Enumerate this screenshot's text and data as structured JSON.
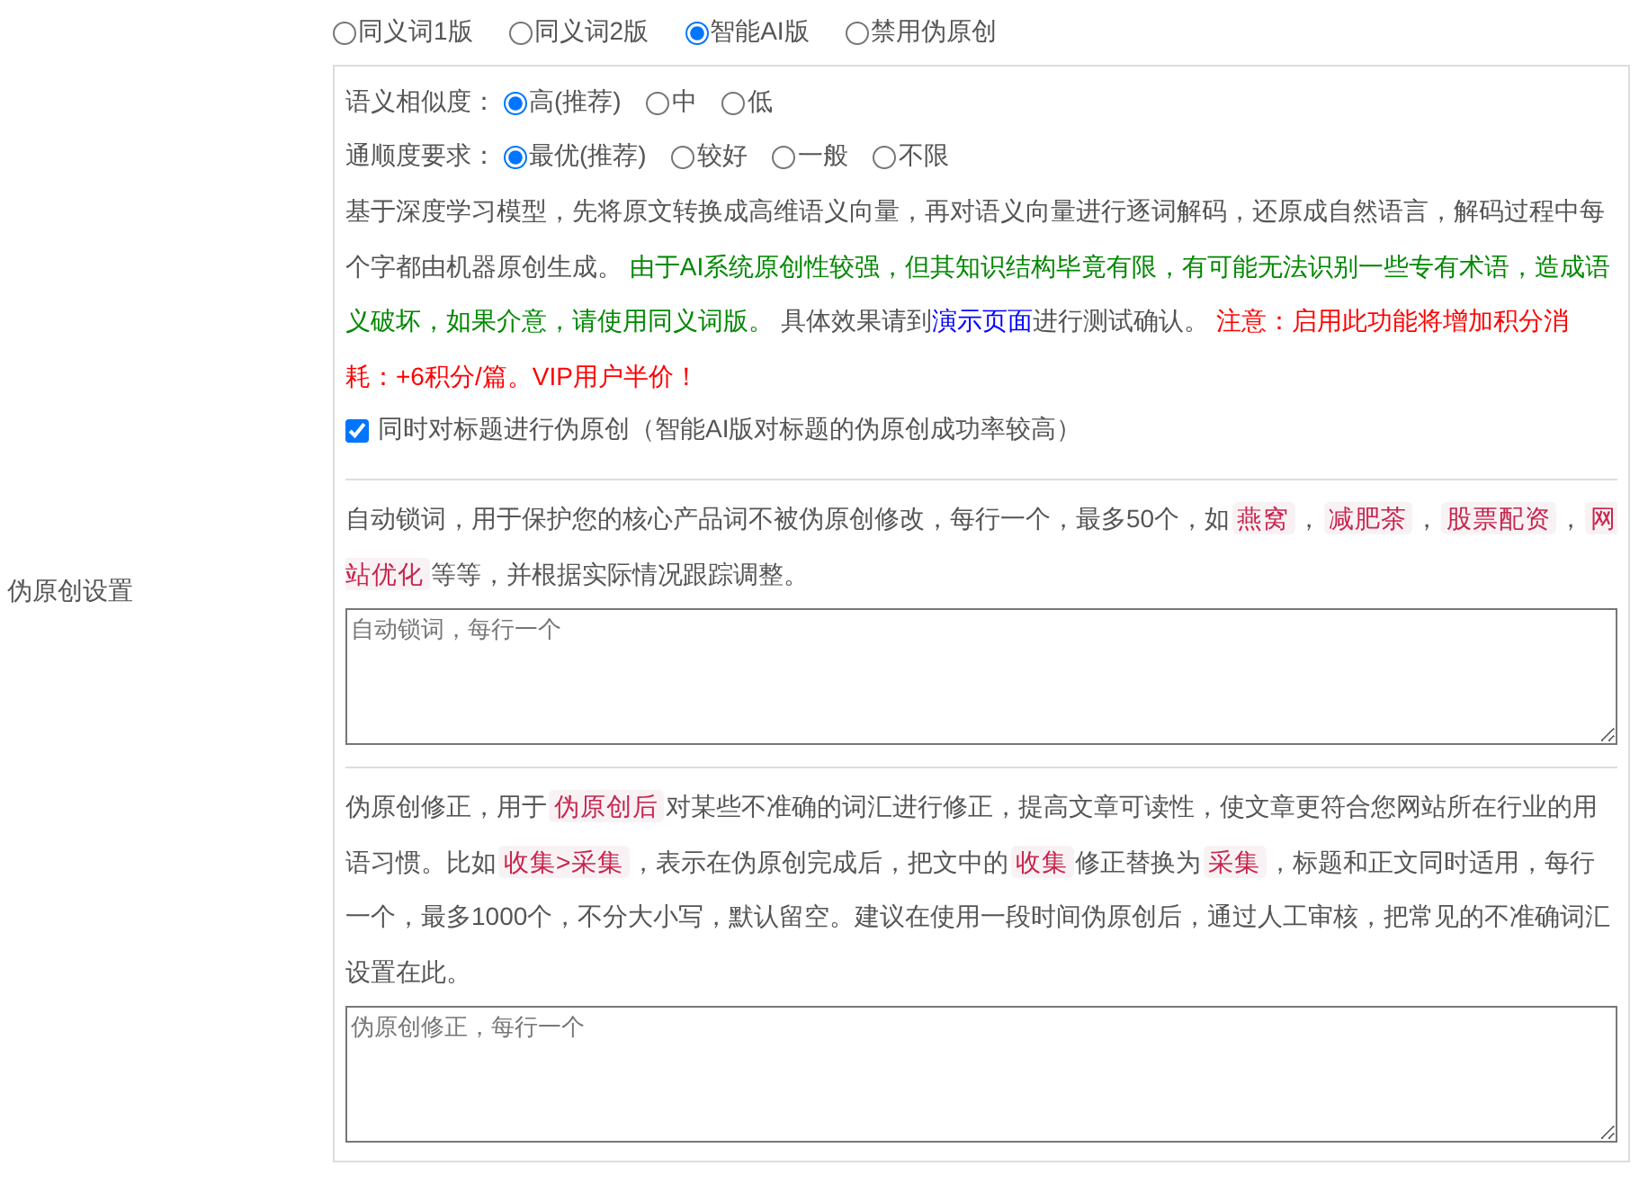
{
  "label": "伪原创设置",
  "versions": [
    {
      "label": "同义词1版",
      "selected": false
    },
    {
      "label": "同义词2版",
      "selected": false
    },
    {
      "label": "智能AI版",
      "selected": true
    },
    {
      "label": "禁用伪原创",
      "selected": false
    }
  ],
  "similarity": {
    "label": "语义相似度：",
    "options": [
      {
        "label": "高(推荐)",
        "selected": true
      },
      {
        "label": "中",
        "selected": false
      },
      {
        "label": "低",
        "selected": false
      }
    ]
  },
  "fluency": {
    "label": "通顺度要求：",
    "options": [
      {
        "label": "最优(推荐)",
        "selected": true
      },
      {
        "label": "较好",
        "selected": false
      },
      {
        "label": "一般",
        "selected": false
      },
      {
        "label": "不限",
        "selected": false
      }
    ]
  },
  "ai_description": [
    {
      "kind": "text",
      "text": "基于深度学习模型，先将原文转换成高维语义向量，再对语义向量进行逐词解码，还原成自然语言，解码过程中每个字都由机器原创生成。 "
    },
    {
      "kind": "notice",
      "text": "由于AI系统原创性较强，但其知识结构毕竟有限，有可能无法识别一些专有术语，造成语义破坏，如果介意，请使用同义词版。"
    },
    {
      "kind": "text",
      "text": " 具体效果请到"
    },
    {
      "kind": "link",
      "text": "演示页面"
    },
    {
      "kind": "text",
      "text": "进行测试确认。 "
    },
    {
      "kind": "warning",
      "text": "注意：启用此功能将增加积分消耗：+6积分/篇。VIP用户半价！"
    }
  ],
  "title_option": {
    "label": "同时对标题进行伪原创（智能AI版对标题的伪原创成功率较高）",
    "checked": true
  },
  "lock_words": {
    "description": [
      {
        "kind": "text",
        "text": "自动锁词，用于保护您的核心产品词不被伪原创修改，每行一个，最多50个，如"
      },
      {
        "kind": "code",
        "text": "燕窝"
      },
      {
        "kind": "text",
        "text": "，"
      },
      {
        "kind": "code",
        "text": "减肥茶"
      },
      {
        "kind": "text",
        "text": "，"
      },
      {
        "kind": "code",
        "text": "股票配资"
      },
      {
        "kind": "text",
        "text": "，"
      },
      {
        "kind": "code",
        "text": "网站优化"
      },
      {
        "kind": "text",
        "text": "等等，并根据实际情况跟踪调整。"
      }
    ],
    "placeholder": "自动锁词，每行一个"
  },
  "correction": {
    "description": [
      {
        "kind": "text",
        "text": "伪原创修正，用于"
      },
      {
        "kind": "code",
        "text": "伪原创后"
      },
      {
        "kind": "text",
        "text": "对某些不准确的词汇进行修正，提高文章可读性，使文章更符合您网站所在行业的用语习惯。比如"
      },
      {
        "kind": "code",
        "text": "收集>采集"
      },
      {
        "kind": "text",
        "text": "，表示在伪原创完成后，把文中的"
      },
      {
        "kind": "code",
        "text": "收集"
      },
      {
        "kind": "text",
        "text": "修正替换为"
      },
      {
        "kind": "code",
        "text": "采集"
      },
      {
        "kind": "text",
        "text": "，标题和正文同时适用，每行一个，最多1000个，不分大小写，默认留空。建议在使用一段时间伪原创后，通过人工审核，把常见的不准确词汇设置在此。"
      }
    ],
    "placeholder": "伪原创修正，每行一个"
  }
}
